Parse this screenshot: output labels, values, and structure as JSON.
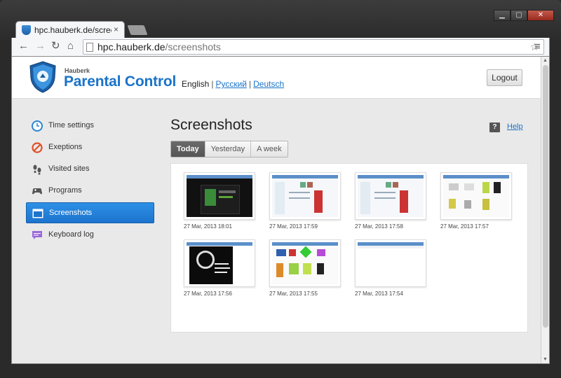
{
  "browser": {
    "tab_title": "hpc.hauberk.de/screensho",
    "tab_close": "×",
    "url_host": "hpc.hauberk.de",
    "url_path": "/screenshots",
    "window_min": "▁",
    "window_max": "▢",
    "window_close": "✕"
  },
  "header": {
    "brand_small": "Hauberk",
    "brand": "Parental Control",
    "lang_current": "English",
    "lang_ru": "Русский",
    "lang_de": "Deutsch",
    "separator": "|",
    "logout_label": "Logout"
  },
  "sidebar": {
    "items": [
      {
        "label": "Time settings",
        "icon": "clock-icon"
      },
      {
        "label": "Exeptions",
        "icon": "forbidden-icon"
      },
      {
        "label": "Visited sites",
        "icon": "footprints-icon"
      },
      {
        "label": "Programs",
        "icon": "gamepad-icon"
      },
      {
        "label": "Screenshots",
        "icon": "window-icon",
        "active": true
      },
      {
        "label": "Keyboard log",
        "icon": "chat-icon"
      }
    ]
  },
  "main": {
    "title": "Screenshots",
    "help_icon": "?",
    "help_label": "Help",
    "period_tabs": [
      "Today",
      "Yesterday",
      "A week"
    ],
    "active_tab": "Today"
  },
  "screenshots": [
    {
      "date": "27 Mar, 2013 18:01"
    },
    {
      "date": "27 Mar, 2013 17:59"
    },
    {
      "date": "27 Mar, 2013 17:58"
    },
    {
      "date": "27 Mar, 2013 17:57"
    },
    {
      "date": "27 Mar, 2013 17:56"
    },
    {
      "date": "27 Mar, 2013 17:55"
    },
    {
      "date": "27 Mar, 2013 17:54"
    }
  ],
  "colors": {
    "brand_blue": "#1a73c8",
    "active_item": "#2e90e6"
  }
}
